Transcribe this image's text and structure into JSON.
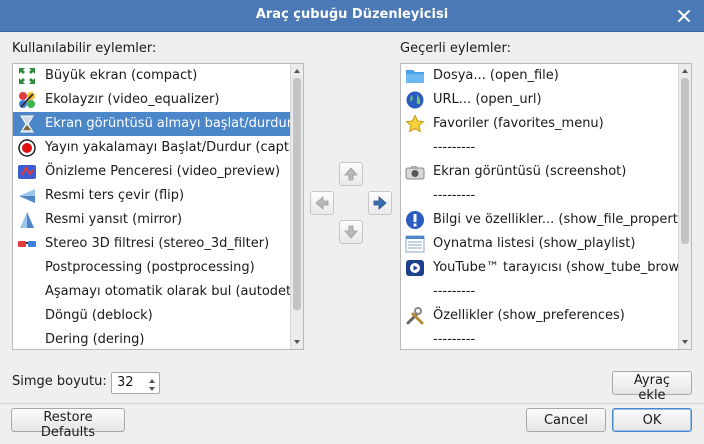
{
  "window": {
    "title": "Araç çubuğu Düzenleyicisi"
  },
  "available": {
    "label": "Kullanılabilir eylemler:",
    "items": [
      {
        "text": "Büyük ekran (compact)",
        "icon": "compact-icon"
      },
      {
        "text": "Ekolayzır (video_equalizer)",
        "icon": "equalizer-icon"
      },
      {
        "text": "Ekran görüntüsü almayı başlat/durdur (",
        "icon": "screenshot-toggle-icon",
        "selected": true
      },
      {
        "text": "Yayın yakalamayı Başlat/Durdur (captu",
        "icon": "record-icon"
      },
      {
        "text": "Önizleme Penceresi (video_preview)",
        "icon": "preview-icon"
      },
      {
        "text": "Resmi ters çevir (flip)",
        "icon": "flip-icon"
      },
      {
        "text": "Resmi yansıt (mirror)",
        "icon": "mirror-icon"
      },
      {
        "text": "Stereo 3D filtresi (stereo_3d_filter)",
        "icon": "stereo-3d-icon"
      },
      {
        "text": "Postprocessing (postprocessing)",
        "icon": ""
      },
      {
        "text": "Aşamayı otomatik olarak bul (autodete",
        "icon": ""
      },
      {
        "text": "Döngü (deblock)",
        "icon": ""
      },
      {
        "text": "Dering (dering)",
        "icon": ""
      }
    ]
  },
  "current": {
    "label": "Geçerli eylemler:",
    "items": [
      {
        "text": "Dosya... (open_file)",
        "icon": "folder-icon"
      },
      {
        "text": "URL... (open_url)",
        "icon": "globe-icon"
      },
      {
        "text": "Favoriler (favorites_menu)",
        "icon": "star-icon"
      },
      {
        "text": "---------",
        "icon": ""
      },
      {
        "text": "Ekran görüntüsü (screenshot)",
        "icon": "camera-icon"
      },
      {
        "text": "---------",
        "icon": ""
      },
      {
        "text": "Bilgi ve özellikler... (show_file_propertie",
        "icon": "info-icon"
      },
      {
        "text": "Oynatma listesi (show_playlist)",
        "icon": "playlist-icon"
      },
      {
        "text": "YouTube™ tarayıcısı (show_tube_brows",
        "icon": "youtube-icon"
      },
      {
        "text": "---------",
        "icon": ""
      },
      {
        "text": "Özellikler (show_preferences)",
        "icon": "tools-icon"
      },
      {
        "text": "---------",
        "icon": ""
      }
    ]
  },
  "icon_size": {
    "label": "Simge boyutu:",
    "value": "32"
  },
  "buttons": {
    "add_separator": "Ayraç ekle",
    "restore_defaults": "Restore Defaults",
    "cancel": "Cancel",
    "ok": "OK"
  },
  "colors": {
    "titlebar": "#4a79b6",
    "selection": "#4a86c8",
    "arrow_right_active": "#3a6fb0"
  }
}
